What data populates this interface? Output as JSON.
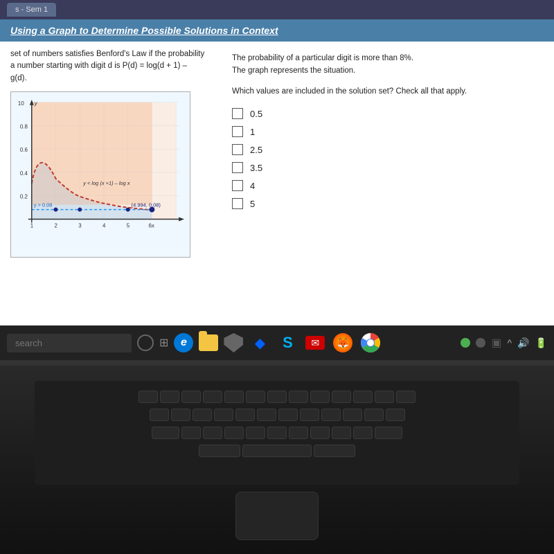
{
  "tab": {
    "label": "s - Sem 1"
  },
  "page_title": "Using a Graph to Determine Possible Solutions in Context",
  "left": {
    "problem_text_1": "set of numbers satisfies Benford's Law if the probability",
    "problem_text_2": "a number starting with digit d is P(d) = log(d + 1) –",
    "problem_text_3": "g(d)."
  },
  "right": {
    "info_line1": "The probability of a particular digit is more than 8%.",
    "info_line2": "The graph represents the situation.",
    "question": "Which values are included in the solution set? Check all that apply.",
    "options": [
      {
        "value": "0.5"
      },
      {
        "value": "1"
      },
      {
        "value": "2.5"
      },
      {
        "value": "3.5"
      },
      {
        "value": "4"
      },
      {
        "value": "5"
      }
    ]
  },
  "graph": {
    "y_label": "y",
    "x_max": "6",
    "annotation_curve": "y < log (x +1) – log x",
    "annotation_line": "y > 0.08",
    "point": "(4.994, 0.08)",
    "y_values": [
      "10",
      "0.8",
      "0.6",
      "0.4",
      "0.2"
    ],
    "x_values": [
      "1",
      "2",
      "3",
      "4",
      "5",
      "6"
    ]
  },
  "taskbar": {
    "search_placeholder": "search",
    "icons": [
      "edge",
      "taskview",
      "files",
      "shield",
      "dropbox",
      "skype",
      "email",
      "firefox",
      "chrome"
    ]
  },
  "system_tray": {
    "volume_icon": "🔊",
    "battery_icon": "🔋"
  }
}
